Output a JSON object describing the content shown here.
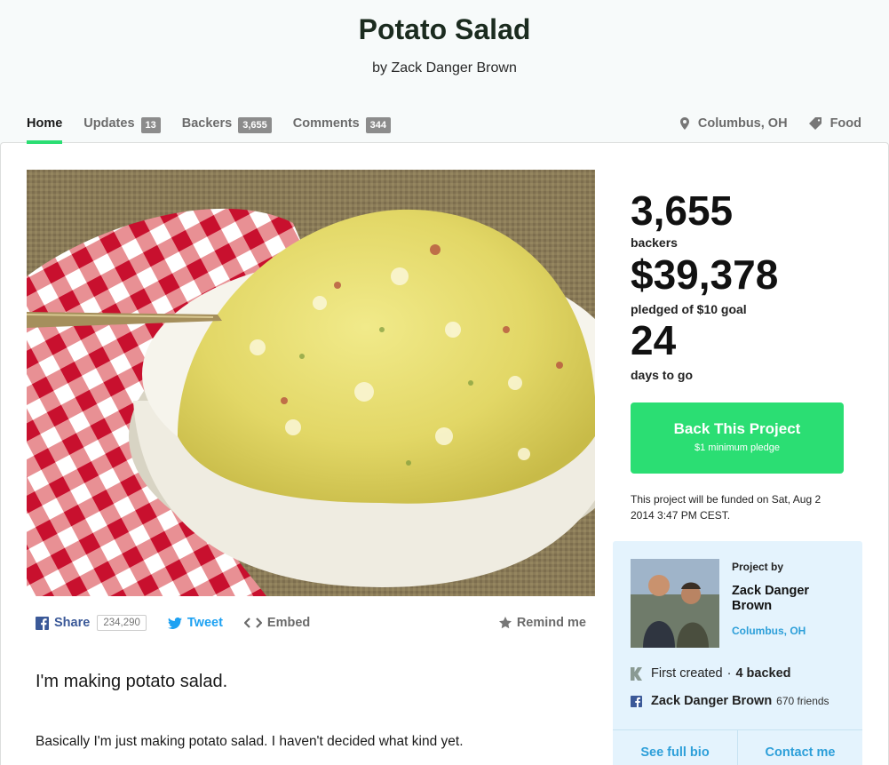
{
  "project": {
    "title": "Potato Salad",
    "byline": "by Zack Danger Brown"
  },
  "tabs": [
    {
      "label": "Home",
      "active": true
    },
    {
      "label": "Updates",
      "count": "13"
    },
    {
      "label": "Backers",
      "count": "3,655"
    },
    {
      "label": "Comments",
      "count": "344"
    }
  ],
  "meta": {
    "location": "Columbus, OH",
    "category": "Food"
  },
  "share": {
    "share_label": "Share",
    "share_count": "234,290",
    "tweet_label": "Tweet",
    "embed_label": "Embed",
    "remind_label": "Remind me"
  },
  "description": {
    "intro": "I'm making potato salad.",
    "paragraph": "Basically I'm just making potato salad. I haven't decided what kind yet."
  },
  "stats": {
    "backers": "3,655",
    "backers_label": "backers",
    "pledged": "$39,378",
    "pledged_label": "pledged of $10 goal",
    "days": "24",
    "days_label": "days to go"
  },
  "back_button": {
    "label": "Back This Project",
    "sub": "$1 minimum pledge"
  },
  "funding_note": "This project will be funded on Sat, Aug 2 2014 3:47 PM CEST.",
  "creator": {
    "project_by": "Project by",
    "name": "Zack Danger Brown",
    "location": "Columbus, OH",
    "first_created": "First created",
    "separator": "·",
    "backed": "4 backed",
    "facebook_name": "Zack Danger Brown",
    "friends": "670 friends",
    "see_bio": "See full bio",
    "contact": "Contact me"
  },
  "colors": {
    "accent_green": "#2bde73",
    "link_blue": "#2d9fd9",
    "creator_box_bg": "#e4f3fd",
    "facebook_blue": "#3b5998",
    "twitter_blue": "#1da1f2"
  }
}
